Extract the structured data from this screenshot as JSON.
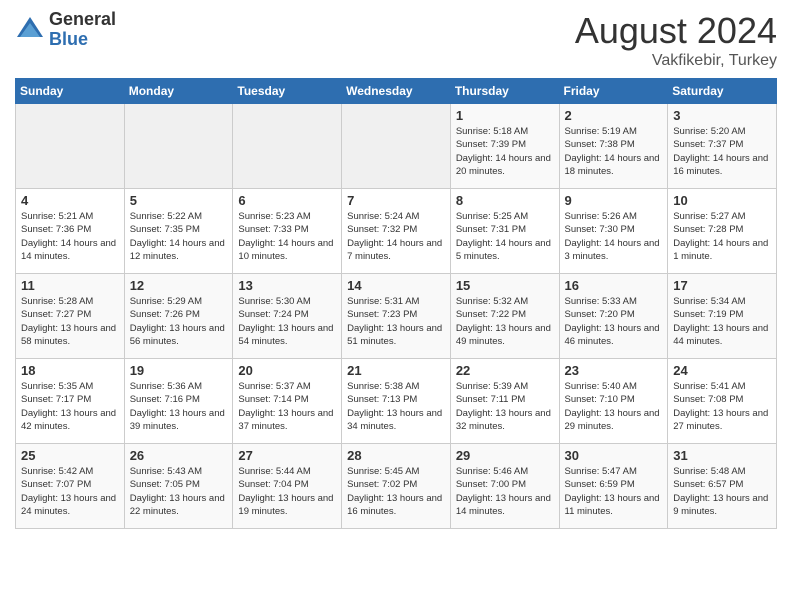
{
  "header": {
    "logo_general": "General",
    "logo_blue": "Blue",
    "month_year": "August 2024",
    "location": "Vakfikebir, Turkey"
  },
  "days_of_week": [
    "Sunday",
    "Monday",
    "Tuesday",
    "Wednesday",
    "Thursday",
    "Friday",
    "Saturday"
  ],
  "weeks": [
    [
      {
        "day": "",
        "info": ""
      },
      {
        "day": "",
        "info": ""
      },
      {
        "day": "",
        "info": ""
      },
      {
        "day": "",
        "info": ""
      },
      {
        "day": "1",
        "info": "Sunrise: 5:18 AM\nSunset: 7:39 PM\nDaylight: 14 hours\nand 20 minutes."
      },
      {
        "day": "2",
        "info": "Sunrise: 5:19 AM\nSunset: 7:38 PM\nDaylight: 14 hours\nand 18 minutes."
      },
      {
        "day": "3",
        "info": "Sunrise: 5:20 AM\nSunset: 7:37 PM\nDaylight: 14 hours\nand 16 minutes."
      }
    ],
    [
      {
        "day": "4",
        "info": "Sunrise: 5:21 AM\nSunset: 7:36 PM\nDaylight: 14 hours\nand 14 minutes."
      },
      {
        "day": "5",
        "info": "Sunrise: 5:22 AM\nSunset: 7:35 PM\nDaylight: 14 hours\nand 12 minutes."
      },
      {
        "day": "6",
        "info": "Sunrise: 5:23 AM\nSunset: 7:33 PM\nDaylight: 14 hours\nand 10 minutes."
      },
      {
        "day": "7",
        "info": "Sunrise: 5:24 AM\nSunset: 7:32 PM\nDaylight: 14 hours\nand 7 minutes."
      },
      {
        "day": "8",
        "info": "Sunrise: 5:25 AM\nSunset: 7:31 PM\nDaylight: 14 hours\nand 5 minutes."
      },
      {
        "day": "9",
        "info": "Sunrise: 5:26 AM\nSunset: 7:30 PM\nDaylight: 14 hours\nand 3 minutes."
      },
      {
        "day": "10",
        "info": "Sunrise: 5:27 AM\nSunset: 7:28 PM\nDaylight: 14 hours\nand 1 minute."
      }
    ],
    [
      {
        "day": "11",
        "info": "Sunrise: 5:28 AM\nSunset: 7:27 PM\nDaylight: 13 hours\nand 58 minutes."
      },
      {
        "day": "12",
        "info": "Sunrise: 5:29 AM\nSunset: 7:26 PM\nDaylight: 13 hours\nand 56 minutes."
      },
      {
        "day": "13",
        "info": "Sunrise: 5:30 AM\nSunset: 7:24 PM\nDaylight: 13 hours\nand 54 minutes."
      },
      {
        "day": "14",
        "info": "Sunrise: 5:31 AM\nSunset: 7:23 PM\nDaylight: 13 hours\nand 51 minutes."
      },
      {
        "day": "15",
        "info": "Sunrise: 5:32 AM\nSunset: 7:22 PM\nDaylight: 13 hours\nand 49 minutes."
      },
      {
        "day": "16",
        "info": "Sunrise: 5:33 AM\nSunset: 7:20 PM\nDaylight: 13 hours\nand 46 minutes."
      },
      {
        "day": "17",
        "info": "Sunrise: 5:34 AM\nSunset: 7:19 PM\nDaylight: 13 hours\nand 44 minutes."
      }
    ],
    [
      {
        "day": "18",
        "info": "Sunrise: 5:35 AM\nSunset: 7:17 PM\nDaylight: 13 hours\nand 42 minutes."
      },
      {
        "day": "19",
        "info": "Sunrise: 5:36 AM\nSunset: 7:16 PM\nDaylight: 13 hours\nand 39 minutes."
      },
      {
        "day": "20",
        "info": "Sunrise: 5:37 AM\nSunset: 7:14 PM\nDaylight: 13 hours\nand 37 minutes."
      },
      {
        "day": "21",
        "info": "Sunrise: 5:38 AM\nSunset: 7:13 PM\nDaylight: 13 hours\nand 34 minutes."
      },
      {
        "day": "22",
        "info": "Sunrise: 5:39 AM\nSunset: 7:11 PM\nDaylight: 13 hours\nand 32 minutes."
      },
      {
        "day": "23",
        "info": "Sunrise: 5:40 AM\nSunset: 7:10 PM\nDaylight: 13 hours\nand 29 minutes."
      },
      {
        "day": "24",
        "info": "Sunrise: 5:41 AM\nSunset: 7:08 PM\nDaylight: 13 hours\nand 27 minutes."
      }
    ],
    [
      {
        "day": "25",
        "info": "Sunrise: 5:42 AM\nSunset: 7:07 PM\nDaylight: 13 hours\nand 24 minutes."
      },
      {
        "day": "26",
        "info": "Sunrise: 5:43 AM\nSunset: 7:05 PM\nDaylight: 13 hours\nand 22 minutes."
      },
      {
        "day": "27",
        "info": "Sunrise: 5:44 AM\nSunset: 7:04 PM\nDaylight: 13 hours\nand 19 minutes."
      },
      {
        "day": "28",
        "info": "Sunrise: 5:45 AM\nSunset: 7:02 PM\nDaylight: 13 hours\nand 16 minutes."
      },
      {
        "day": "29",
        "info": "Sunrise: 5:46 AM\nSunset: 7:00 PM\nDaylight: 13 hours\nand 14 minutes."
      },
      {
        "day": "30",
        "info": "Sunrise: 5:47 AM\nSunset: 6:59 PM\nDaylight: 13 hours\nand 11 minutes."
      },
      {
        "day": "31",
        "info": "Sunrise: 5:48 AM\nSunset: 6:57 PM\nDaylight: 13 hours\nand 9 minutes."
      }
    ]
  ]
}
